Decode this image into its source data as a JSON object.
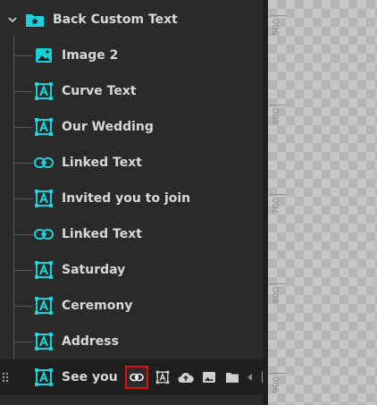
{
  "layers": {
    "root": {
      "label": "Back Custom Text"
    },
    "items": [
      {
        "label": "Image 2",
        "icon": "image-icon"
      },
      {
        "label": "Curve Text",
        "icon": "text-box-icon"
      },
      {
        "label": "Our Wedding",
        "icon": "text-box-icon"
      },
      {
        "label": "Linked Text",
        "icon": "link-icon"
      },
      {
        "label": "Invited you to join",
        "icon": "text-box-icon"
      },
      {
        "label": "Linked Text",
        "icon": "link-icon"
      },
      {
        "label": "Saturday",
        "icon": "text-box-icon"
      },
      {
        "label": "Ceremony",
        "icon": "text-box-icon"
      },
      {
        "label": "Address",
        "icon": "text-box-icon"
      },
      {
        "label": "See you",
        "icon": "text-box-icon"
      }
    ]
  },
  "ruler": {
    "labels": [
      "500",
      "600",
      "700",
      "800",
      "900"
    ]
  },
  "colors": {
    "accent": "#19d3da",
    "highlight": "#e01010"
  }
}
